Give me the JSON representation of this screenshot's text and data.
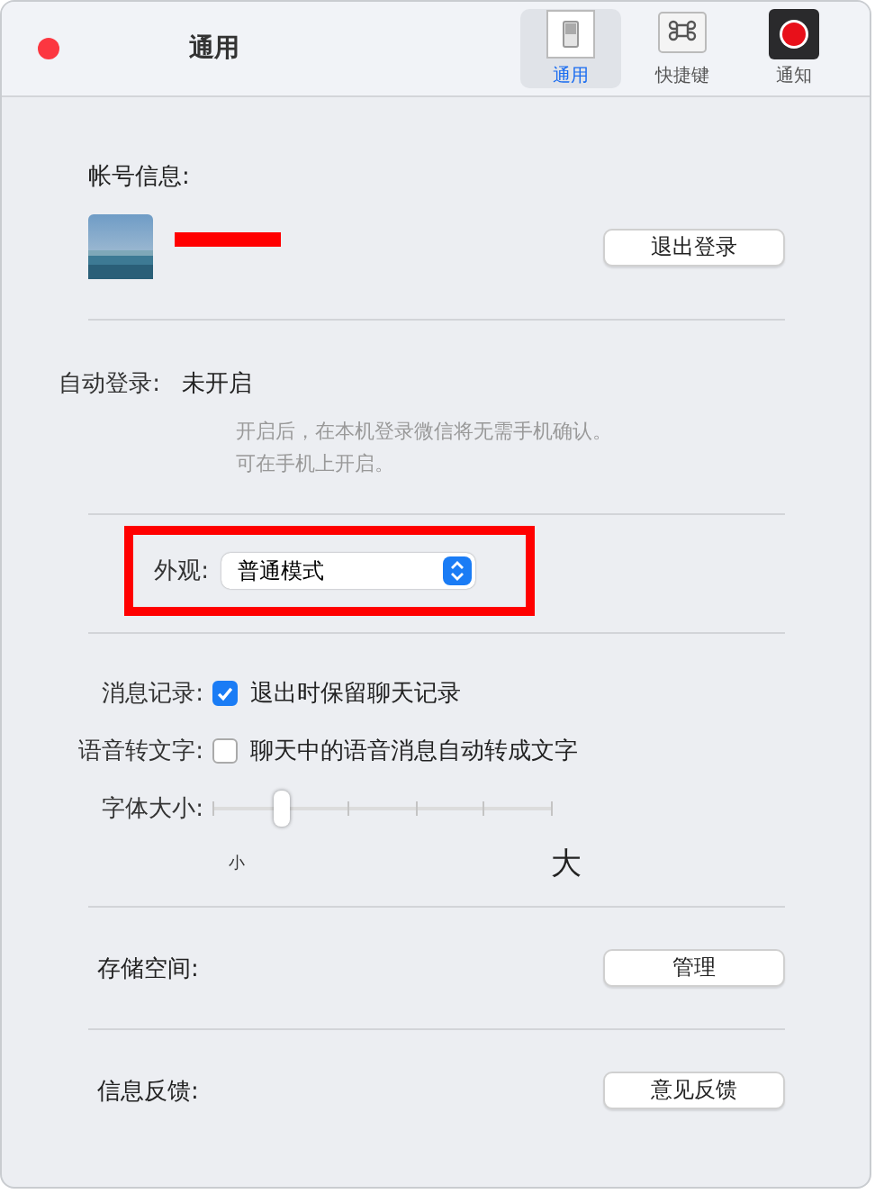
{
  "window": {
    "title": "通用"
  },
  "toolbar": [
    {
      "label": "通用",
      "selected": true,
      "kind": "switch"
    },
    {
      "label": "快捷键",
      "selected": false,
      "kind": "command"
    },
    {
      "label": "通知",
      "selected": false,
      "kind": "record"
    }
  ],
  "account": {
    "label": "帐号信息:",
    "name_redacted": true,
    "logout_button": "退出登录"
  },
  "auto_login": {
    "label": "自动登录:",
    "value": "未开启",
    "hint": [
      "开启后，在本机登录微信将无需手机确认。",
      "可在手机上开启。"
    ]
  },
  "appearance": {
    "label": "外观:",
    "value": "普通模式",
    "highlighted": true
  },
  "options": [
    {
      "label": "消息记录:",
      "text": "退出时保留聊天记录",
      "checked": true
    },
    {
      "label": "语音转文字:",
      "text": "聊天中的语音消息自动转成文字",
      "checked": false
    }
  ],
  "font_size": {
    "label": "字体大小:",
    "level": 0.2,
    "min_label": "小",
    "max_label": "大"
  },
  "storage": {
    "label": "存储空间:",
    "button": "管理"
  },
  "feedback": {
    "label": "信息反馈:",
    "button": "意见反馈"
  }
}
